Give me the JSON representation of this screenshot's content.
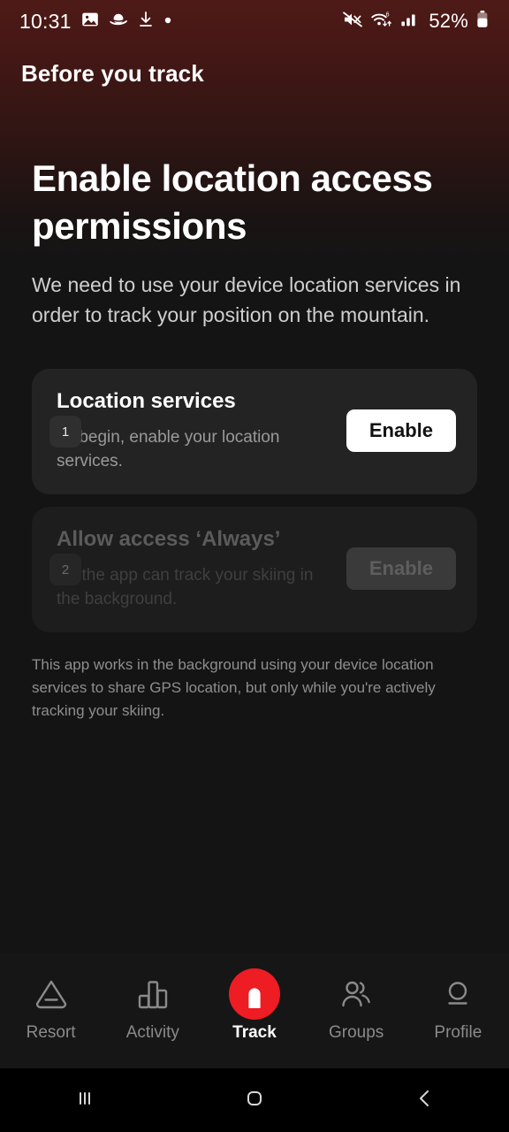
{
  "status_bar": {
    "time": "10:31",
    "battery_percent": "52%",
    "left_icons": [
      "photo-icon",
      "saturn-icon",
      "download-icon",
      "dot-icon"
    ],
    "right_icons": [
      "mute-icon",
      "wifi-icon",
      "cellular-signal-icon",
      "battery-icon"
    ]
  },
  "header": {
    "title": "Before you track"
  },
  "main": {
    "title": "Enable location access permissions",
    "subtitle": "We need to use your device location services in order to track your position on the mountain.",
    "steps": [
      {
        "badge": "1",
        "title": "Location services",
        "description": "To begin, enable your location services.",
        "button_label": "Enable",
        "disabled": false
      },
      {
        "badge": "2",
        "title": "Allow access ‘Always’",
        "description": "So the app can track your skiing in the background.",
        "button_label": "Enable",
        "disabled": true
      }
    ],
    "disclaimer": "This app works in the background using your device location services to share GPS location, but only while you're actively tracking your skiing."
  },
  "tab_bar": {
    "items": [
      {
        "label": "Resort",
        "icon": "mountain-icon",
        "active": false
      },
      {
        "label": "Activity",
        "icon": "bar-chart-icon",
        "active": false
      },
      {
        "label": "Track",
        "icon": "track-icon",
        "active": true
      },
      {
        "label": "Groups",
        "icon": "people-icon",
        "active": false
      },
      {
        "label": "Profile",
        "icon": "person-icon",
        "active": false
      }
    ]
  },
  "android_nav": {
    "recents_label": "recents-icon",
    "home_label": "home-icon",
    "back_label": "back-icon"
  },
  "colors": {
    "accent_red": "#ee1c23",
    "header_gradient_top": "#4e1a17",
    "page_background": "#141414",
    "card_background": "#232323",
    "card_background_disabled": "#1d1d1d"
  }
}
